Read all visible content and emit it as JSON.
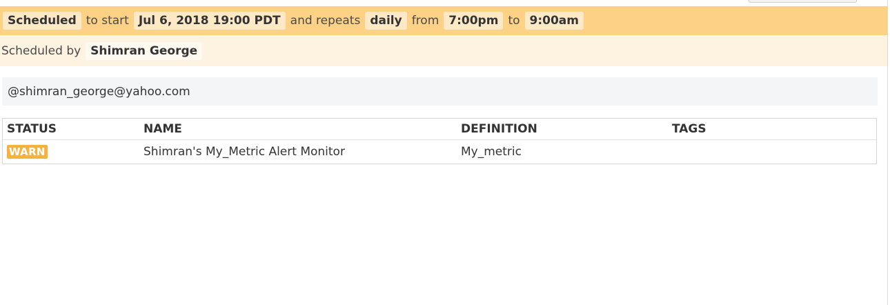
{
  "schedule": {
    "status_label": "Scheduled",
    "to_start_text": "to start",
    "start_datetime": "Jul 6, 2018 19:00 PDT",
    "and_repeats_text": "and repeats",
    "frequency": "daily",
    "from_text": "from",
    "from_time": "7:00pm",
    "to_text": "to",
    "to_time": "9:00am",
    "colors": {
      "bar": "#fdd186",
      "chip": "#fde9c6"
    }
  },
  "scheduled_by": {
    "prefix": "Scheduled by",
    "user_name": "Shimran George"
  },
  "notification": {
    "recipient": "@shimran_george@yahoo.com"
  },
  "monitors_table": {
    "headers": {
      "status": "STATUS",
      "name": "NAME",
      "definition": "DEFINITION",
      "tags": "TAGS"
    },
    "rows": [
      {
        "status": "WARN",
        "name": "Shimran's My_Metric Alert Monitor",
        "definition": "My_metric",
        "tags": ""
      }
    ],
    "colors": {
      "warn": "#f8b13d"
    }
  }
}
